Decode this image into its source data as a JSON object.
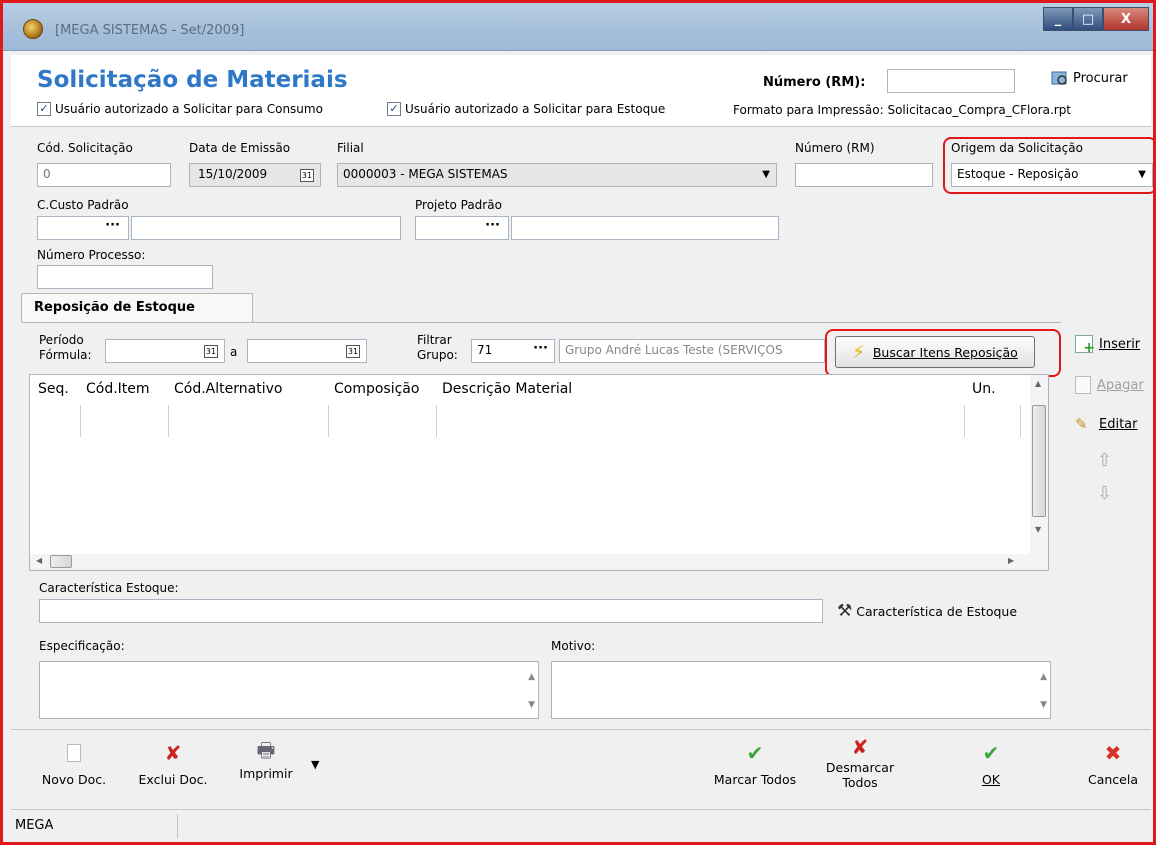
{
  "window": {
    "title": "[MEGA SISTEMAS - Set/2009]",
    "min": "_",
    "max": "□",
    "close": "X"
  },
  "header": {
    "title": "Solicitação de Materiais",
    "numero_label": "Número (RM):",
    "numero_value": "",
    "procurar": "Procurar",
    "chk_consumo": "Usuário autorizado a Solicitar para Consumo",
    "chk_estoque": "Usuário autorizado a Solicitar para Estoque",
    "formato": "Formato para Impressão: Solicitacao_Compra_CFlora.rpt"
  },
  "form": {
    "cod_label": "Cód. Solicitação",
    "cod_value": "0",
    "data_label": "Data de Emissão",
    "data_value": "15/10/2009",
    "filial_label": "Filial",
    "filial_value": "0000003 - MEGA SISTEMAS",
    "numero_label": "Número (RM)",
    "numero_value": "",
    "origem_label": "Origem da Solicitação",
    "origem_value": "Estoque - Reposição",
    "ccusto_label": "C.Custo Padrão",
    "projeto_label": "Projeto Padrão",
    "processo_label": "Número Processo:"
  },
  "tab": {
    "label": "Reposição de Estoque",
    "periodo_label1": "Período",
    "periodo_label2": "Fórmula:",
    "a_label": "a",
    "filtrar_label1": "Filtrar",
    "filtrar_label2": "Grupo:",
    "grupo_code": "71",
    "grupo_desc": "Grupo André Lucas Teste (SERVIÇOS",
    "buscar": "Buscar Itens Reposição"
  },
  "grid": {
    "columns": [
      "Seq.",
      "Cód.Item",
      "Cód.Alternativo",
      "Composição",
      "Descrição Material",
      "Un."
    ]
  },
  "side": {
    "inserir": "Inserir",
    "apagar": "Apagar",
    "editar": "Editar"
  },
  "details": {
    "caracteristica_label": "Característica Estoque:",
    "caracteristica_btn": "Característica de Estoque",
    "especificacao_label": "Especificação:",
    "motivo_label": "Motivo:"
  },
  "toolbar": {
    "novo": "Novo Doc.",
    "exclui": "Exclui Doc.",
    "imprimir": "Imprimir",
    "marcar": "Marcar Todos",
    "desmarcar1": "Desmarcar",
    "desmarcar2": "Todos",
    "ok": "OK",
    "cancela": "Cancela"
  },
  "status": {
    "text": "MEGA"
  },
  "colors": {
    "title": "#2f78c8",
    "highlight": "#e0181b",
    "check_green": "#3aa53a",
    "cancel_red": "#d9302a"
  }
}
